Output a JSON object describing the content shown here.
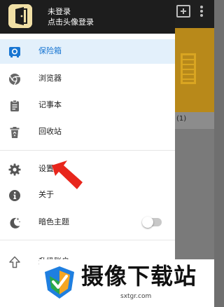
{
  "user": {
    "name": "未登录",
    "hint": "点击头像登录"
  },
  "menu": {
    "vault": "保险箱",
    "browser": "浏览器",
    "notepad": "记事本",
    "recycle": "回收站",
    "settings": "设置",
    "about": "关于",
    "dark_theme": "暗色主题",
    "upgrade": "升级账户"
  },
  "dark_theme_enabled": false,
  "background": {
    "card_caption": "(1)"
  },
  "watermark": {
    "title": "摄像下载站",
    "url": "sxtgr.com"
  },
  "colors": {
    "accent": "#1976d2",
    "active_bg": "#e3f0fb",
    "header_bg": "#1d1d1d",
    "arrow": "#e8261c"
  }
}
